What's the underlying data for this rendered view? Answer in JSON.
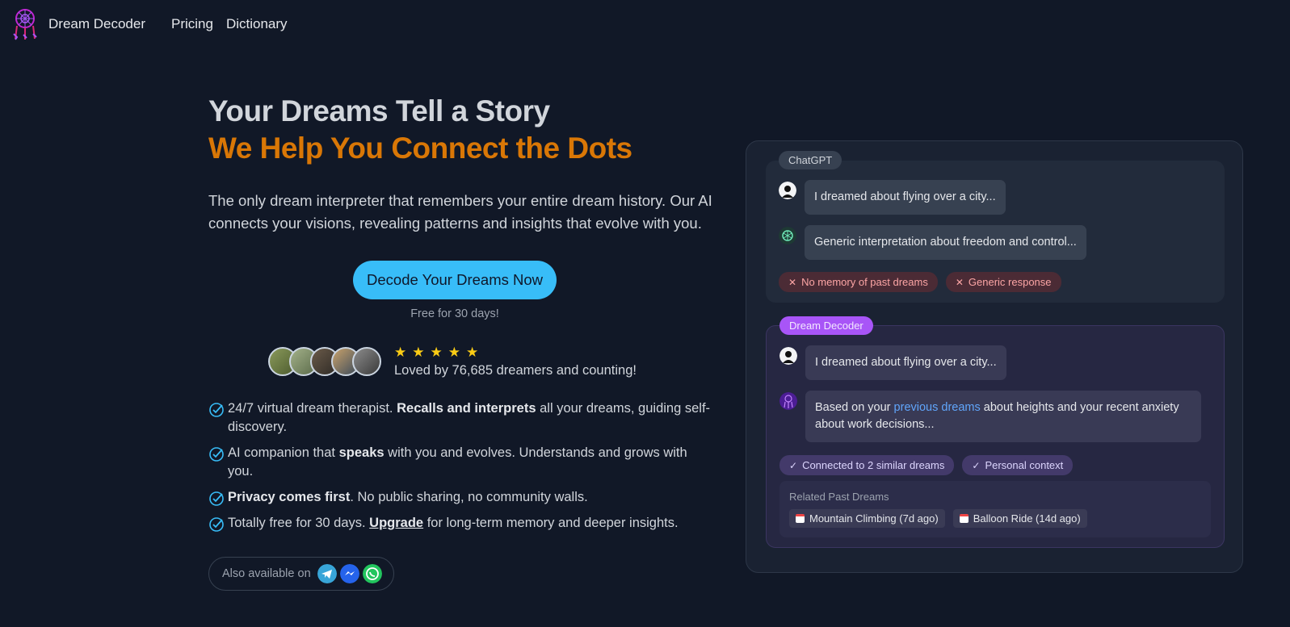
{
  "nav": {
    "brand": "Dream Decoder",
    "links": [
      "Pricing",
      "Dictionary"
    ]
  },
  "hero": {
    "title_line1": "Your Dreams Tell a Story",
    "title_line2": "We Help You Connect the Dots",
    "lead": "The only dream interpreter that remembers your entire dream history. Our AI connects your visions, revealing patterns and insights that evolve with you.",
    "cta_label": "Decode Your Dreams Now",
    "cta_note": "Free for 30 days!",
    "stars": "★★★★★",
    "loved": "Loved by 76,685 dreamers and counting!"
  },
  "features": [
    {
      "pre": "24/7 virtual dream therapist. ",
      "bold": "Recalls and interprets",
      "post": " all your dreams, guiding self-discovery."
    },
    {
      "pre": "AI companion that ",
      "bold": "speaks",
      "post": " with you and evolves. Understands and grows with you."
    },
    {
      "pre": "",
      "bold": "Privacy comes first",
      "post": ". No public sharing, no community walls."
    },
    {
      "pre": "Totally free for 30 days. ",
      "bold": "Upgrade",
      "post": " for long-term memory and deeper insights."
    }
  ],
  "also": {
    "label": "Also available on",
    "icons": [
      "telegram-icon",
      "messenger-icon",
      "whatsapp-icon"
    ]
  },
  "compare": {
    "gpt": {
      "tag": "ChatGPT",
      "user_msg": "I dreamed about flying over a city...",
      "ai_msg": "Generic interpretation about freedom and control...",
      "chips": [
        "No memory of past dreams",
        "Generic response"
      ]
    },
    "dd": {
      "tag": "Dream Decoder",
      "user_msg": "I dreamed about flying over a city...",
      "ai_msg_pre": "Based on your ",
      "ai_msg_link": "previous dreams",
      "ai_msg_post": " about heights and your recent anxiety about work decisions...",
      "chips": [
        "Connected to 2 similar dreams",
        "Personal context"
      ],
      "related_title": "Related Past Dreams",
      "related": [
        "Mountain Climbing (7d ago)",
        "Balloon Ride (14d ago)"
      ]
    }
  },
  "colors": {
    "background": "#111827",
    "accent_orange": "#d97706",
    "cta_blue": "#38bdf8",
    "purple": "#a855f7"
  }
}
